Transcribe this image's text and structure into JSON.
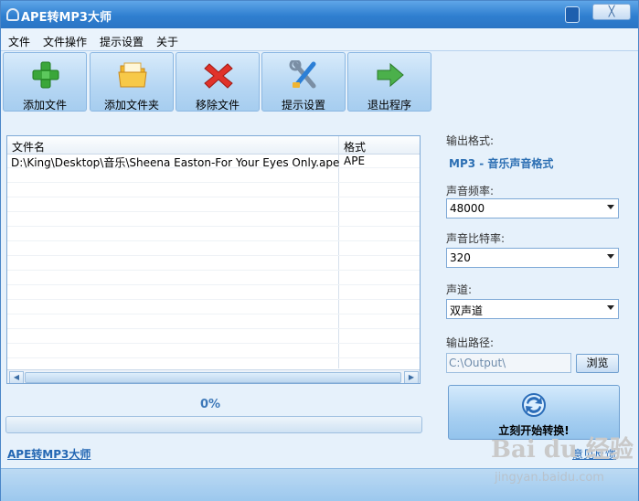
{
  "window": {
    "title": "APE转MP3大师",
    "close_label": "╳"
  },
  "menu": {
    "items": [
      "文件",
      "文件操作",
      "提示设置",
      "关于"
    ]
  },
  "toolbar": {
    "buttons": [
      {
        "label": "添加文件",
        "icon": "add-plus-icon"
      },
      {
        "label": "添加文件夹",
        "icon": "folder-icon"
      },
      {
        "label": "移除文件",
        "icon": "remove-x-icon"
      },
      {
        "label": "提示设置",
        "icon": "tools-icon"
      },
      {
        "label": "退出程序",
        "icon": "exit-arrow-icon"
      }
    ]
  },
  "file_list": {
    "headers": {
      "name": "文件名",
      "format": "格式"
    },
    "rows": [
      {
        "name": "D:\\King\\Desktop\\音乐\\Sheena Easton-For Your Eyes Only.ape",
        "format": "APE"
      }
    ]
  },
  "progress": {
    "percent_label": "0%",
    "value": 0
  },
  "settings": {
    "output_format_label": "输出格式:",
    "output_format_value": "MP3 - 音乐声音格式",
    "sample_rate_label": "声音频率:",
    "sample_rate_value": "48000",
    "bitrate_label": "声音比特率:",
    "bitrate_value": "320",
    "channel_label": "声道:",
    "channel_value": "双声道",
    "output_path_label": "输出路径:",
    "output_path_value": "C:\\Output\\",
    "browse_label": "浏览"
  },
  "convert": {
    "label": "立刻开始转换!"
  },
  "footer": {
    "app_link": "APE转MP3大师",
    "feedback_link": "意见反馈"
  },
  "watermark": {
    "logo": "Bai du 经验",
    "url": "jingyan.baidu.com"
  },
  "colors": {
    "title_bar": "#2f7fd0",
    "accent_text": "#2c6fb3",
    "background": "#e6f1fb"
  }
}
